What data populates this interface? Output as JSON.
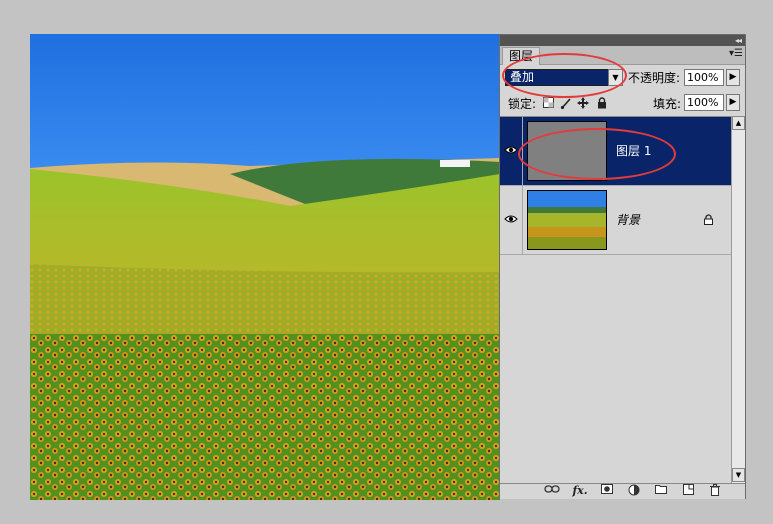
{
  "panel": {
    "tab_label": "图层",
    "collapse_glyph": "◂◂",
    "menu_glyph": "▾☰"
  },
  "blend": {
    "value": "叠加",
    "arrow": "▼"
  },
  "opacity": {
    "label": "不透明度:",
    "value": "100%",
    "step": "▶"
  },
  "lock": {
    "label": "锁定:",
    "icons": [
      "lock-transparent-icon",
      "lock-paint-icon",
      "lock-position-icon",
      "lock-all-icon"
    ]
  },
  "fill": {
    "label": "填充:",
    "value": "100%",
    "step": "▶"
  },
  "layers": [
    {
      "name": "图层 1",
      "selected": true,
      "visible": true,
      "thumb": "gray"
    },
    {
      "name": "背景",
      "selected": false,
      "visible": true,
      "thumb": "sunflower",
      "locked": true
    }
  ],
  "scroll": {
    "up": "▲",
    "down": "▼"
  },
  "bottom_icons": [
    "link-icon",
    "fx-icon",
    "mask-icon",
    "adjustment-icon",
    "group-folder-icon",
    "new-layer-icon",
    "trash-icon"
  ],
  "colors": {
    "selection": "#0a246a",
    "annotation": "#e33b3b",
    "sky": "#2f7fe6",
    "panel": "#d6d6d6"
  }
}
